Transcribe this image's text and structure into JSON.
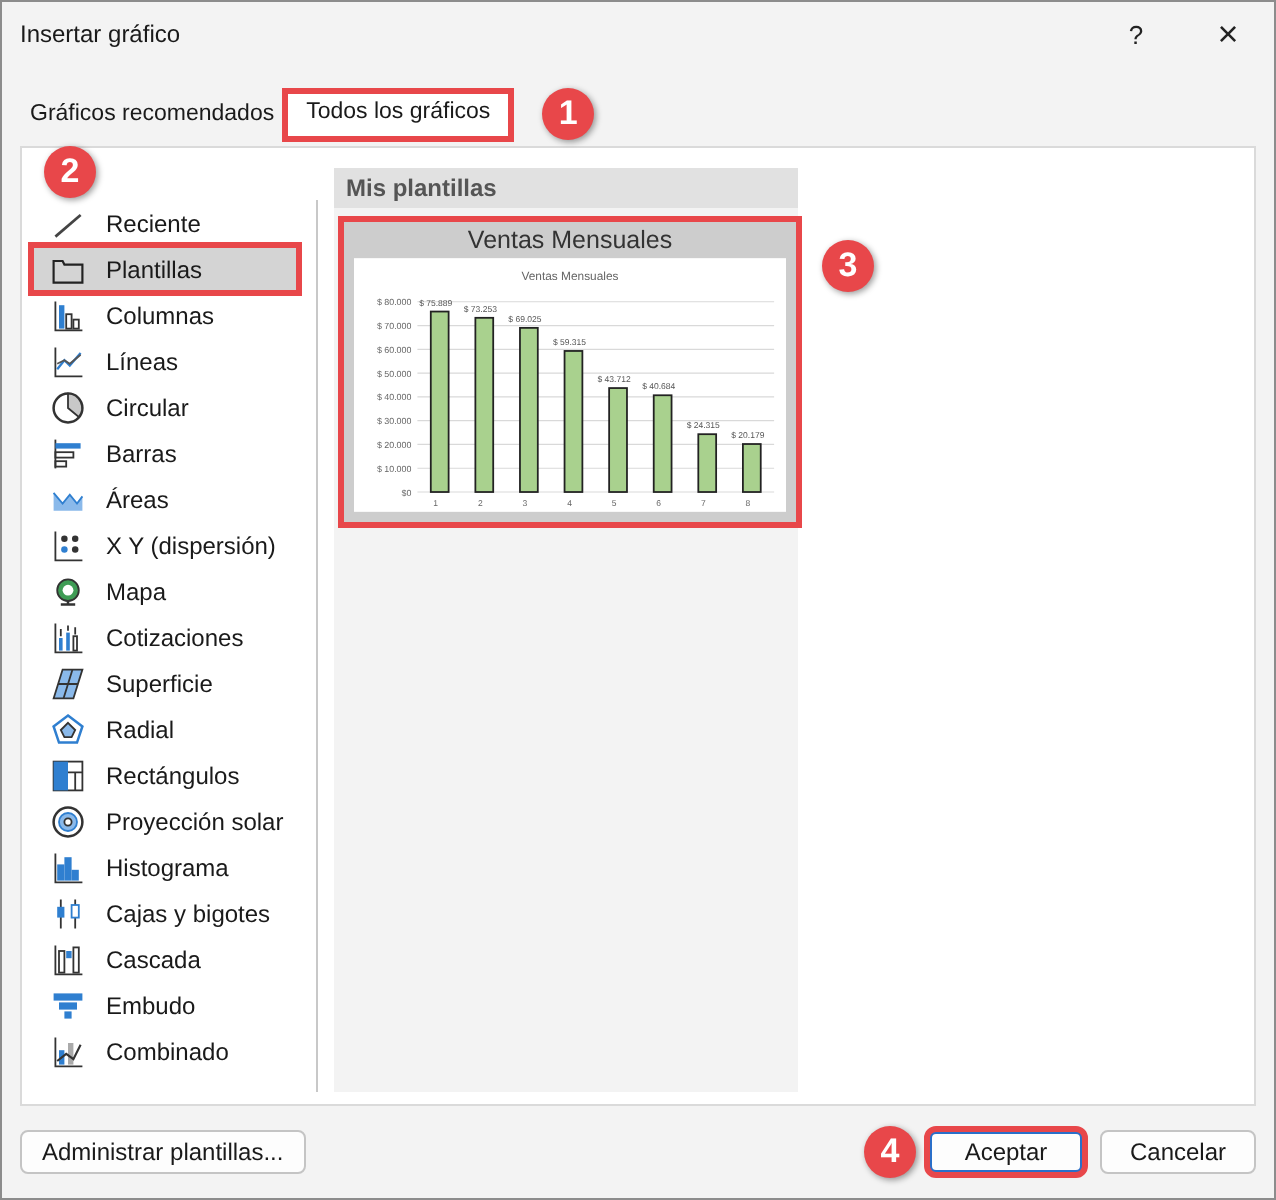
{
  "window": {
    "title": "Insertar gráfico",
    "help": "?",
    "close": "×"
  },
  "tabs": [
    {
      "label": "Gráficos recomendados",
      "selected": false
    },
    {
      "label": "Todos los gráficos",
      "selected": true,
      "callout": "1"
    }
  ],
  "sidebar": {
    "items": [
      {
        "label": "Reciente",
        "selected": false
      },
      {
        "label": "Plantillas",
        "selected": true,
        "callout": "2"
      },
      {
        "label": "Columnas",
        "selected": false
      },
      {
        "label": "Líneas",
        "selected": false
      },
      {
        "label": "Circular",
        "selected": false
      },
      {
        "label": "Barras",
        "selected": false
      },
      {
        "label": "Áreas",
        "selected": false
      },
      {
        "label": "X Y (dispersión)",
        "selected": false
      },
      {
        "label": "Mapa",
        "selected": false
      },
      {
        "label": "Cotizaciones",
        "selected": false
      },
      {
        "label": "Superficie",
        "selected": false
      },
      {
        "label": "Radial",
        "selected": false
      },
      {
        "label": "Rectángulos",
        "selected": false
      },
      {
        "label": "Proyección solar",
        "selected": false
      },
      {
        "label": "Histograma",
        "selected": false
      },
      {
        "label": "Cajas y bigotes",
        "selected": false
      },
      {
        "label": "Cascada",
        "selected": false
      },
      {
        "label": "Embudo",
        "selected": false
      },
      {
        "label": "Combinado",
        "selected": false
      }
    ]
  },
  "templates": {
    "heading": "Mis plantillas",
    "items": [
      {
        "name": "Ventas Mensuales",
        "callout": "3",
        "chart_data": {
          "type": "bar",
          "title": "Ventas Mensuales",
          "grid": true,
          "categories": [
            "1",
            "2",
            "3",
            "4",
            "5",
            "6",
            "7",
            "8"
          ],
          "series": [
            {
              "color": "#a9d18e",
              "values": [
                75889,
                73253,
                69025,
                59315,
                43712,
                40684,
                24315,
                20179
              ]
            }
          ],
          "ylim": [
            0,
            80000
          ],
          "yticks": [
            {
              "value": 0,
              "label": "$0"
            },
            {
              "value": 10000,
              "label": "$ 10.000"
            },
            {
              "value": 20000,
              "label": "$ 20.000"
            },
            {
              "value": 30000,
              "label": "$ 30.000"
            },
            {
              "value": 40000,
              "label": "$ 40.000"
            },
            {
              "value": 50000,
              "label": "$ 50.000"
            },
            {
              "value": 60000,
              "label": "$ 60.000"
            },
            {
              "value": 70000,
              "label": "$ 70.000"
            },
            {
              "value": 80000,
              "label": "$ 80.000"
            }
          ],
          "value_labels": [
            "$ 75.889",
            "$ 73.253",
            "$ 69.025",
            "$ 59.315",
            "$ 43.712",
            "$ 40.684",
            "$ 24.315",
            "$ 20.179"
          ]
        }
      }
    ]
  },
  "buttons": [
    {
      "label": "Administrar plantillas...",
      "default": false
    },
    {
      "label": "Aceptar",
      "default": true,
      "callout": "4"
    },
    {
      "label": "Cancelar",
      "default": false
    }
  ]
}
